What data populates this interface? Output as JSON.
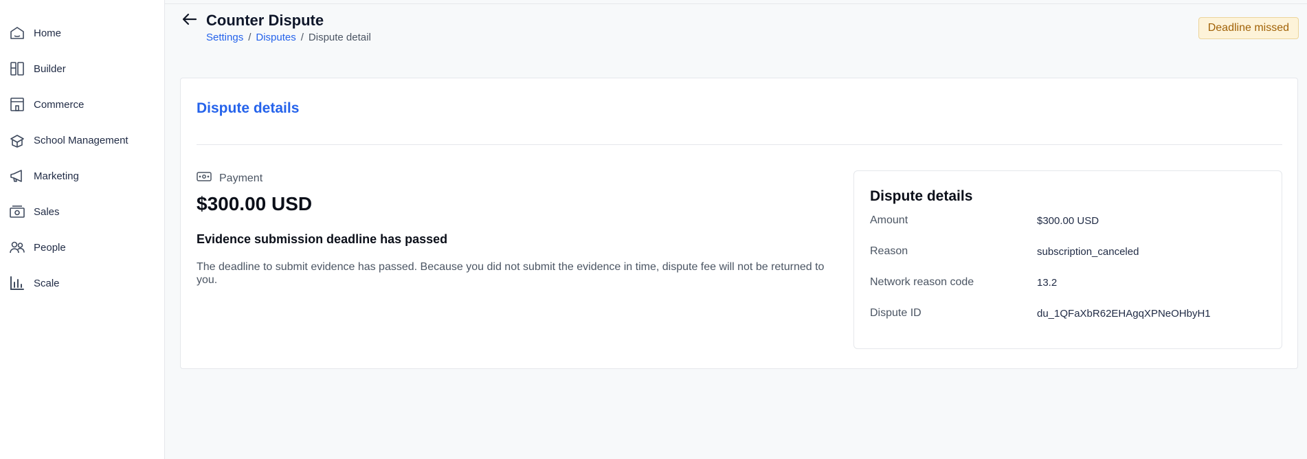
{
  "sidebar": {
    "items": [
      {
        "label": "Home",
        "icon": "home-icon"
      },
      {
        "label": "Builder",
        "icon": "builder-icon"
      },
      {
        "label": "Commerce",
        "icon": "storefront-icon"
      },
      {
        "label": "School Management",
        "icon": "school-icon"
      },
      {
        "label": "Marketing",
        "icon": "megaphone-icon"
      },
      {
        "label": "Sales",
        "icon": "cash-icon"
      },
      {
        "label": "People",
        "icon": "people-icon"
      },
      {
        "label": "Scale",
        "icon": "bar-chart-icon"
      }
    ]
  },
  "header": {
    "title": "Counter Dispute",
    "breadcrumb": {
      "settings": "Settings",
      "sep1": "/",
      "disputes": "Disputes",
      "sep2": "/",
      "current": "Dispute detail"
    },
    "status_badge": "Deadline missed"
  },
  "card": {
    "title": "Dispute details",
    "payment_label": "Payment",
    "amount": "$300.00 USD",
    "notice_title": "Evidence submission deadline has passed",
    "notice_text": "The deadline to submit evidence has passed. Because you did not submit the evidence in time, dispute fee will not be returned to you."
  },
  "details": {
    "title": "Dispute details",
    "rows": [
      {
        "key": "Amount",
        "value": "$300.00 USD"
      },
      {
        "key": "Reason",
        "value": "subscription_canceled"
      },
      {
        "key": "Network reason code",
        "value": "13.2"
      },
      {
        "key": "Dispute ID",
        "value": "du_1QFaXbR62EHAgqXPNeOHbyH1"
      }
    ]
  },
  "colors": {
    "accent": "#2563eb",
    "badge_bg": "#fdf3d9",
    "badge_text": "#a16207"
  }
}
